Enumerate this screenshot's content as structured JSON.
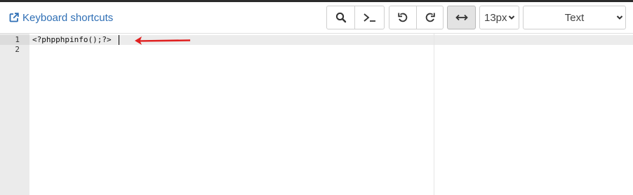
{
  "toolbar": {
    "keyboard_shortcuts_label": "Keyboard shortcuts",
    "font_size": "13px",
    "mode": "Text",
    "icons": {
      "link": "external-link-icon",
      "search": "search-icon",
      "terminal": "terminal-icon",
      "undo": "undo-icon",
      "redo": "redo-icon",
      "wrap": "wrap-toggle-icon",
      "dropdown": "chevron-down-icon"
    }
  },
  "editor": {
    "lines": [
      {
        "number": "1",
        "text": "<?phpphpinfo();?>"
      },
      {
        "number": "2",
        "text": ""
      }
    ]
  },
  "annotation": {
    "color": "#e02020",
    "icon": "red-arrow-icon"
  }
}
